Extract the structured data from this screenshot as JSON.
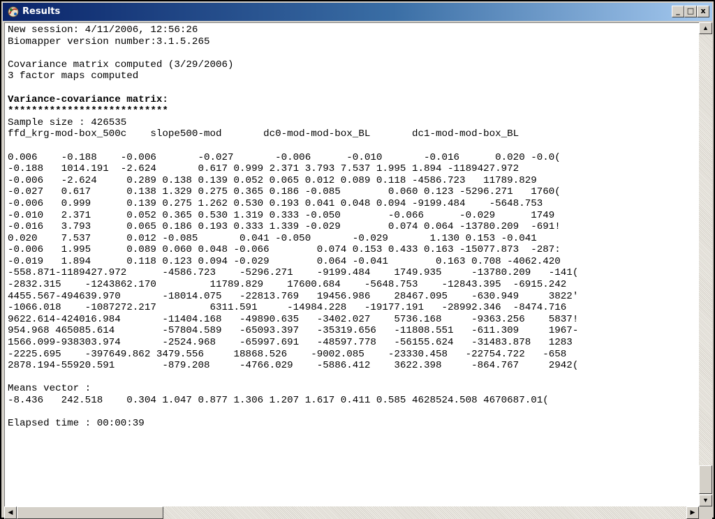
{
  "window": {
    "title": "Results",
    "controls": {
      "minimize": "_",
      "maximize": "□",
      "close": "x"
    }
  },
  "icons": {
    "app": "biomapper-app-icon"
  },
  "output": {
    "lines": [
      {
        "text": "New session: 4/11/2006, 12:56:26",
        "bold": false
      },
      {
        "text": "Biomapper version number:3.1.5.265",
        "bold": false
      },
      {
        "text": "",
        "bold": false
      },
      {
        "text": "Covariance matrix computed (3/29/2006)",
        "bold": false
      },
      {
        "text": "3 factor maps computed",
        "bold": false
      },
      {
        "text": "",
        "bold": false
      },
      {
        "text": "Variance-covariance matrix:",
        "bold": true
      },
      {
        "text": "***************************",
        "bold": true
      },
      {
        "text": "Sample size : 426535",
        "bold": false
      },
      {
        "text": "ffd_krg-mod-box_500c    slope500-mod       dc0-mod-mod-box_BL       dc1-mod-mod-box_BL",
        "bold": false
      },
      {
        "text": "",
        "bold": false
      },
      {
        "text": "0.006    -0.188    -0.006       -0.027       -0.006      -0.010       -0.016      0.020 -0.0(",
        "bold": false
      },
      {
        "text": "-0.188   1014.191  -2.624       0.617 0.999 2.371 3.793 7.537 1.995 1.894 -1189427.972",
        "bold": false
      },
      {
        "text": "-0.006   -2.624     0.289 0.138 0.139 0.052 0.065 0.012 0.089 0.118 -4586.723   11789.829",
        "bold": false
      },
      {
        "text": "-0.027   0.617      0.138 1.329 0.275 0.365 0.186 -0.085        0.060 0.123 -5296.271   1760(",
        "bold": false
      },
      {
        "text": "-0.006   0.999      0.139 0.275 1.262 0.530 0.193 0.041 0.048 0.094 -9199.484    -5648.753",
        "bold": false
      },
      {
        "text": "-0.010   2.371      0.052 0.365 0.530 1.319 0.333 -0.050        -0.066      -0.029      1749",
        "bold": false
      },
      {
        "text": "-0.016   3.793      0.065 0.186 0.193 0.333 1.339 -0.029        0.074 0.064 -13780.209  -691!",
        "bold": false
      },
      {
        "text": "0.020    7.537      0.012 -0.085       0.041 -0.050       -0.029       1.130 0.153 -0.041",
        "bold": false
      },
      {
        "text": "-0.006   1.995      0.089 0.060 0.048 -0.066        0.074 0.153 0.433 0.163 -15077.873  -287:",
        "bold": false
      },
      {
        "text": "-0.019   1.894      0.118 0.123 0.094 -0.029        0.064 -0.041        0.163 0.708 -4062.420",
        "bold": false
      },
      {
        "text": "-558.871-1189427.972      -4586.723    -5296.271    -9199.484    1749.935     -13780.209   -141(",
        "bold": false
      },
      {
        "text": "-2832.315    -1243862.170         11789.829    17600.684    -5648.753    -12843.395  -6915.242",
        "bold": false
      },
      {
        "text": "4455.567-494639.970       -18014.075   -22813.769   19456.986    28467.095    -630.949     3822'",
        "bold": false
      },
      {
        "text": "-1066.018    -1087272.217         6311.591     -14984.228   -19177.191   -28992.346  -8474.716",
        "bold": false
      },
      {
        "text": "9622.614-424016.984       -11404.168   -49890.635   -3402.027    5736.168     -9363.256    5837!",
        "bold": false
      },
      {
        "text": "954.968 465085.614        -57804.589   -65093.397   -35319.656   -11808.551   -611.309     1967-",
        "bold": false
      },
      {
        "text": "1566.099-938303.974       -2524.968    -65997.691   -48597.778   -56155.624   -31483.878   1283",
        "bold": false
      },
      {
        "text": "-2225.695    -397649.862 3479.556     18868.526    -9002.085    -23330.458   -22754.722   -658",
        "bold": false
      },
      {
        "text": "2878.194-55920.591        -879.208     -4766.029    -5886.412    3622.398     -864.767     2942(",
        "bold": false
      },
      {
        "text": "",
        "bold": false
      },
      {
        "text": "Means vector :",
        "bold": false
      },
      {
        "text": "-8.436   242.518    0.304 1.047 0.877 1.306 1.207 1.617 0.411 0.585 4628524.508 4670687.01(",
        "bold": false
      },
      {
        "text": "",
        "bold": false
      },
      {
        "text": "Elapsed time : 00:00:39",
        "bold": false
      }
    ]
  },
  "scrollbars": {
    "vertical": {
      "up_arrow": "▲",
      "down_arrow": "▼"
    },
    "horizontal": {
      "left_arrow": "◀",
      "right_arrow": "▶"
    }
  }
}
